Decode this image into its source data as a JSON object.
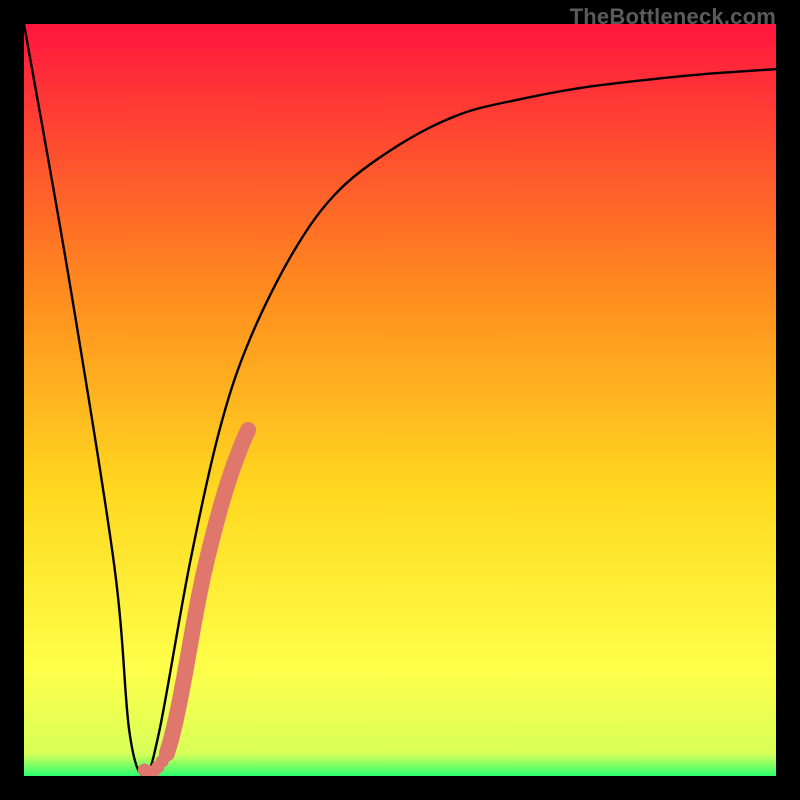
{
  "watermark": "TheBottleneck.com",
  "colors": {
    "frame": "#000000",
    "gradient_top": "#ff163e",
    "gradient_mid1": "#ff8a1f",
    "gradient_mid2": "#ffd81f",
    "gradient_mid3": "#ffff4a",
    "gradient_bottom": "#2bff6e",
    "curve": "#000000",
    "marker": "#e0776d"
  },
  "chart_data": {
    "type": "line",
    "title": "",
    "xlabel": "",
    "ylabel": "",
    "xlim": [
      0,
      100
    ],
    "ylim": [
      0,
      100
    ],
    "series": [
      {
        "name": "bottleneck-curve",
        "x": [
          0,
          6,
          12,
          14,
          16,
          18,
          22,
          26,
          30,
          36,
          42,
          50,
          58,
          66,
          74,
          82,
          90,
          100
        ],
        "y": [
          100,
          66,
          28,
          6,
          0,
          6,
          28,
          46,
          58,
          70,
          78,
          84,
          88,
          90,
          91.5,
          92.5,
          93.3,
          94
        ]
      }
    ],
    "markers": {
      "name": "highlight-segment",
      "x": [
        19.0,
        19.6,
        20.2,
        20.8,
        21.4,
        22.0,
        22.6,
        23.2,
        23.8,
        24.4,
        25.0,
        25.6,
        26.2,
        26.8,
        27.4,
        28.0,
        28.6,
        29.2,
        29.8
      ],
      "y": [
        3.0,
        5.0,
        7.5,
        10.4,
        13.6,
        17.0,
        20.4,
        23.6,
        26.5,
        29.1,
        31.5,
        33.8,
        36.0,
        38.0,
        39.9,
        41.6,
        43.2,
        44.7,
        46.0
      ]
    },
    "tail_dots": {
      "name": "tail-dots",
      "x": [
        16.0,
        16.6,
        17.2,
        17.8,
        18.4
      ],
      "y": [
        0.8,
        0.4,
        0.6,
        1.2,
        2.0
      ]
    }
  }
}
